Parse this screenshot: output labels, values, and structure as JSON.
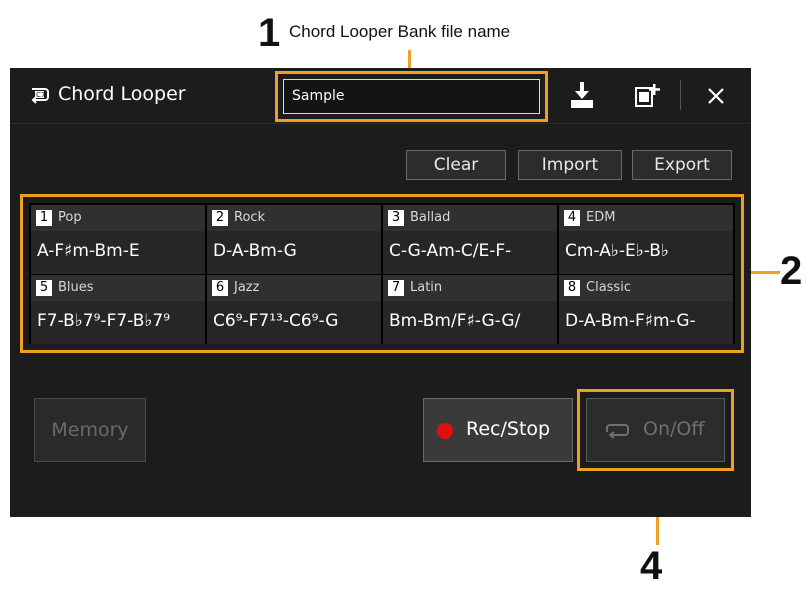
{
  "callouts": {
    "one": "1",
    "one_caption": "Chord Looper Bank file name",
    "two": "2",
    "four": "4"
  },
  "window": {
    "title": "Chord Looper",
    "bank_name": "Sample"
  },
  "toolbar": {
    "icons": [
      "save-icon",
      "new-bank-icon",
      "close-icon"
    ]
  },
  "actions": {
    "clear": "Clear",
    "import": "Import",
    "export": "Export"
  },
  "slots": [
    {
      "num": "1",
      "name": "Pop",
      "chords": "A-F♯m-Bm-E"
    },
    {
      "num": "2",
      "name": "Rock",
      "chords": "D-A-Bm-G"
    },
    {
      "num": "3",
      "name": "Ballad",
      "chords": "C-G-Am-C/E-F-"
    },
    {
      "num": "4",
      "name": "EDM",
      "chords": "Cm-A♭-E♭-B♭"
    },
    {
      "num": "5",
      "name": "Blues",
      "chords": "F7-B♭7⁹-F7-B♭7⁹"
    },
    {
      "num": "6",
      "name": "Jazz",
      "chords": "C6⁹-F7¹³-C6⁹-G"
    },
    {
      "num": "7",
      "name": "Latin",
      "chords": "Bm-Bm/F♯-G-G/"
    },
    {
      "num": "8",
      "name": "Classic",
      "chords": "D-A-Bm-F♯m-G-"
    }
  ],
  "controls": {
    "memory": "Memory",
    "rec_stop": "Rec/Stop",
    "on_off": "On/Off"
  },
  "colors": {
    "highlight": "#f0a020",
    "record": "#e01010",
    "panel": "#1c1c1c"
  }
}
